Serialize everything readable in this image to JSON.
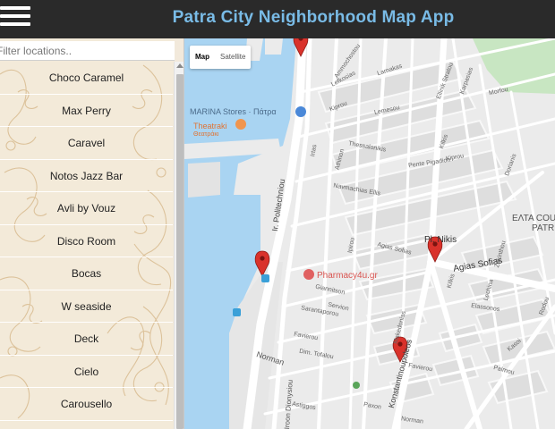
{
  "header": {
    "title": "Patra City Neighborhood Map App",
    "menu_icon": "hamburger-menu-icon",
    "background": "#2a2a2a",
    "title_color": "#79bbe6"
  },
  "sidebar": {
    "filter": {
      "placeholder": "Filter locations..",
      "value": ""
    },
    "locations": [
      "Choco Caramel",
      "Max Perry",
      "Caravel",
      "Notos Jazz Bar",
      "Avli by Vouz",
      "Disco Room",
      "Bocas",
      "W seaside",
      "Deck",
      "Cielo",
      "Carousello"
    ]
  },
  "map": {
    "type_control": {
      "map": "Map",
      "satellite": "Satellite",
      "selected": "Map"
    },
    "marker_color": "#d9322b",
    "water_color": "#a9d4f2",
    "park_color": "#c8e6c2",
    "pois": {
      "marina": "MARINA Stores · Πάτρα",
      "theatraki": "Theatraki",
      "theatraki_greek": "Θεατράκι",
      "pharmacy": "Pharmacy4u.gr",
      "elta": "ΕΛΤΑ COU",
      "elta2": "PATR",
      "pl_nikis": "Pl. Nikis"
    },
    "streets": {
      "politechniou": "Ir. Politechniou",
      "dionysiou": "Iroon Dionysiou",
      "konstantinoupoleos": "Konstantinoupoleos",
      "agias_sofias": "Agias Sofias",
      "agias_sofias_small": "Agias Sofias",
      "norman": "Norman",
      "norman2": "Norman",
      "larnakas": "Larnakas",
      "lefkosias": "Lefkosias",
      "kiprou": "Kiprou",
      "lemesou": "Lemesou",
      "morfou": "Morfou",
      "thessalonikis": "Thessalonikis",
      "pente_pigadion": "Pente Pigadion",
      "navmachias_ellis": "Navmachias Ellis",
      "giannitson": "Giannitson",
      "servion": "Servion",
      "sarantaporou": "Sarantaporou",
      "favierou": "Favierou",
      "favierou2": "Favierou",
      "dim_tofalou": "Dim. Tofalou",
      "elassonos": "Elassonos",
      "makedonias": "Makedonias",
      "astiggos": "Astiggos",
      "paxon": "Paxon",
      "kasoi": "Kasoi",
      "palmou": "Palmou",
      "rodou": "Rodou",
      "kilkis": "Kilkis",
      "lechina": "Lechina",
      "zakinthou": "Zakinthou",
      "ipirou": "Ipirou",
      "athinon": "Athinon",
      "irtas": "Irtas",
      "ammochostou": "Ammochostou",
      "elliniki_stratou": "Ellinik Stratou",
      "karpasias": "Karpasias",
      "dorianis": "Dorianis",
      "kilkis2": "Kilkis",
      "kiprou2": "Kiprou"
    }
  }
}
